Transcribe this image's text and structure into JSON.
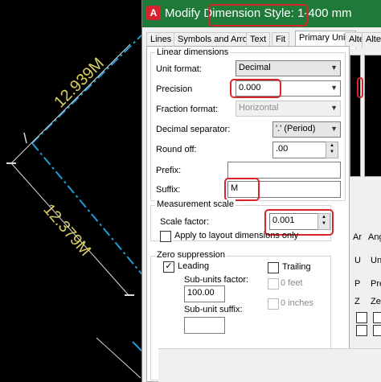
{
  "dialog": {
    "title": "Modify Dimension Style: 1-400 mm",
    "logo_letter": "A",
    "tabs": [
      "Lines",
      "Symbols and Arrows",
      "Text",
      "Fit",
      "Primary Units",
      "Alte",
      "Altern"
    ],
    "active_tab": "Primary Units"
  },
  "cad": {
    "dim_text_1": "12.939M",
    "dim_text_2": "12.379M",
    "line_color": "#1e9bd7",
    "text_color": "#d8cf63"
  },
  "linear": {
    "group_label": "Linear dimensions",
    "unit_format_label": "Unit format:",
    "unit_format_value": "Decimal",
    "precision_label": "Precision",
    "precision_value": "0.000",
    "fraction_format_label": "Fraction format:",
    "fraction_format_value": "Horizontal",
    "decimal_separator_label": "Decimal separator:",
    "decimal_separator_value": "'.' (Period)",
    "round_off_label": "Round off:",
    "round_off_value": ".00",
    "prefix_label": "Prefix:",
    "prefix_value": "",
    "suffix_label": "Suffix:",
    "suffix_value": "M"
  },
  "measurement": {
    "group_label": "Measurement scale",
    "scale_factor_label": "Scale factor:",
    "scale_factor_value": "0.001",
    "apply_layout_label": "Apply to layout dimensions only"
  },
  "zero": {
    "group_label": "Zero suppression",
    "leading_label": "Leading",
    "trailing_label": "Trailing",
    "sub_units_factor_label": "Sub-units factor:",
    "sub_units_factor_value": "100.00",
    "sub_unit_suffix_label": "Sub-unit suffix:",
    "sub_unit_suffix_value": "",
    "feet_label": "0 feet",
    "inches_label": "0 inches"
  },
  "right_column": {
    "ar": "Ar",
    "ang": "Ang",
    "u": "U",
    "uni": "Uni",
    "p": "P",
    "pre": "Pre",
    "z": "Z",
    "zer": "Zer"
  },
  "highlight_color": "#d9262a"
}
